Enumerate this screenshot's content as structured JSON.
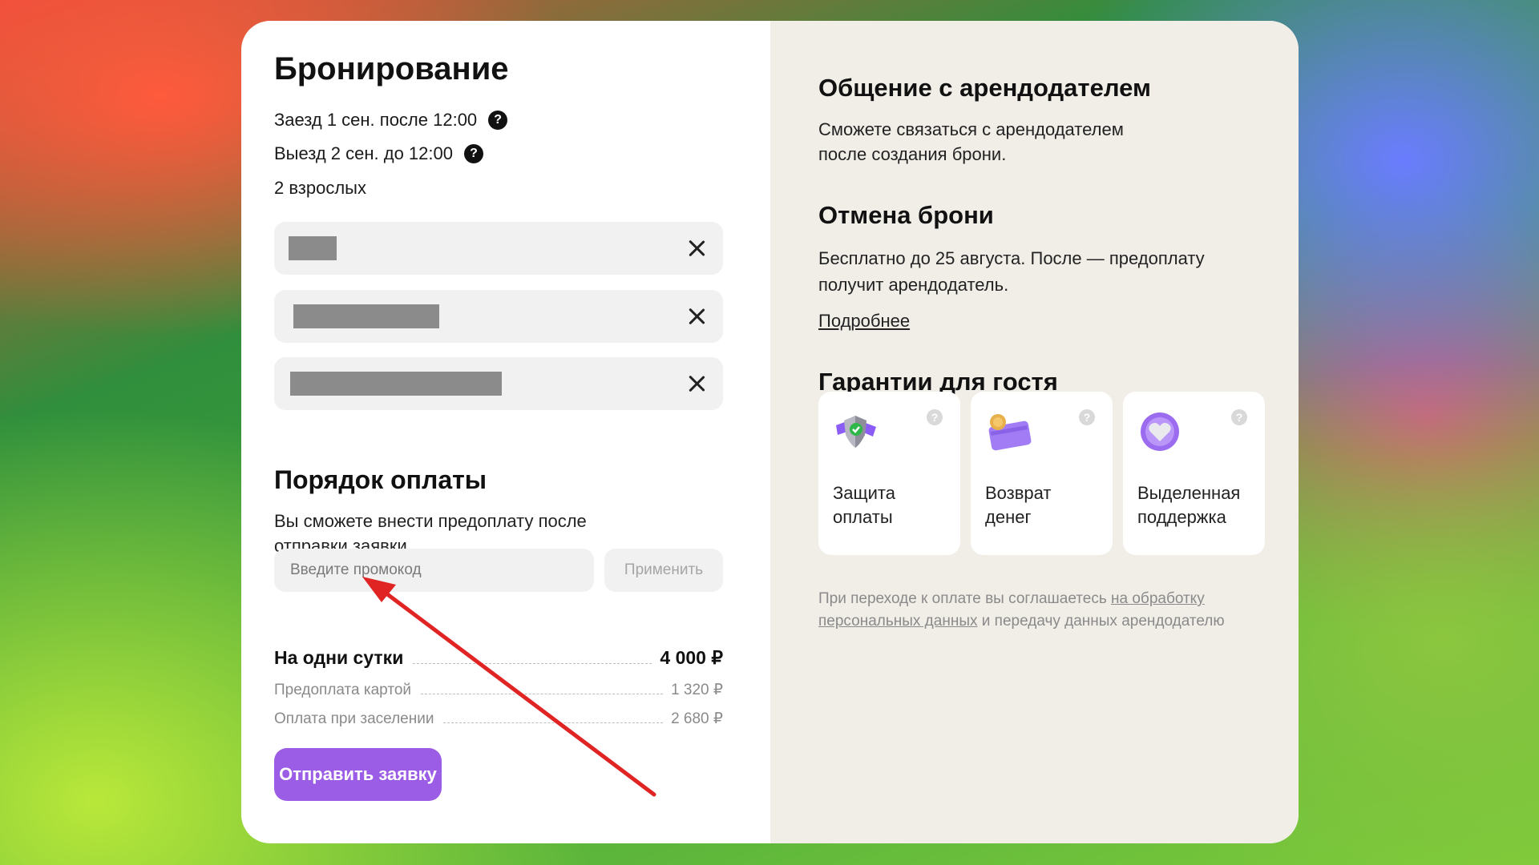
{
  "booking": {
    "title": "Бронирование",
    "checkin": "Заезд 1 сен. после 12:00",
    "checkout": "Выезд 2 сен. до 12:00",
    "guests_count": "2 взрослых",
    "help_icon": "?"
  },
  "payment": {
    "title": "Порядок оплаты",
    "description": "Вы сможете внести предоплату после отправки заявки.",
    "promo_placeholder": "Введите промокод",
    "apply_label": "Применить",
    "per_day_label": "На одни сутки",
    "per_day_value": "4 000 ₽",
    "prepay_label": "Предоплата картой",
    "prepay_value": "1 320 ₽",
    "onsite_label": "Оплата при заселении",
    "onsite_value": "2 680 ₽",
    "submit_label": "Отправить заявку"
  },
  "contact": {
    "title": "Общение с арендодателем",
    "text_line1": "Сможете связаться с арендодателем",
    "text_line2": "после создания брони."
  },
  "cancel": {
    "title": "Отмена брони",
    "text_line1": "Бесплатно до 25 августа. После — предоплату",
    "text_line2": "получит арендодатель.",
    "more_link": "Подробнее"
  },
  "guarantees": {
    "title": "Гарантии для гостя",
    "items": [
      {
        "line1": "Защита",
        "line2": "оплаты",
        "icon": "shield-icon"
      },
      {
        "line1": "Возврат",
        "line2": "денег",
        "icon": "card-coin-icon"
      },
      {
        "line1": "Выделенная",
        "line2": "поддержка",
        "icon": "heart-icon"
      }
    ],
    "help_icon": "?"
  },
  "legal": {
    "prefix": "При переходе к оплате вы соглашаетесь ",
    "link": "на обработку персональных данных",
    "suffix": " и передачу данных арендодателю"
  },
  "colors": {
    "accent": "#9b5de5",
    "annotation_arrow": "#e02424"
  }
}
